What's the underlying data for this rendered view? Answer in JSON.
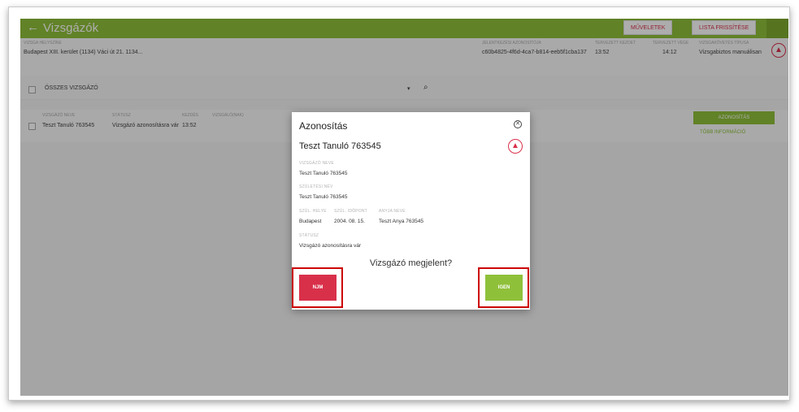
{
  "topbar": {
    "back_icon": "arrow-left-icon",
    "title": "Vizsgázók",
    "actions_label": "MŰVELETEK",
    "refresh_label": "LISTA FRISSÍTÉSE"
  },
  "exam_info": {
    "location_label": "VIZSGA HELYSZÍNE",
    "location_value": "Budapest XIII. kerület (1134) Váci út 21. 1134...",
    "id_label": "JELENTKEZÉSI AZONOSÍTÓJA",
    "id_value": "c60b4825-4f6d-4ca7-b814-eeb5f1cba137",
    "planned_start_label": "TERVEZETT KEZDET",
    "planned_start_value": "13:52",
    "planned_end_label": "TERVEZETT VÉGE",
    "planned_end_value": "14:12",
    "exam_type_label": "VIZSGAKÖVETÉS TÍPUSA",
    "exam_type_value": "Vizsgabiztos manuálisan"
  },
  "filter": {
    "all_label": "ÖSSZES VIZSGÁZÓ"
  },
  "table": {
    "headers": [
      "VIZSGÁZÓ NEVE",
      "STÁTUSZ",
      "KEZDÉS",
      "VIZSGÁLÓ(NAK)"
    ],
    "row": {
      "name": "Teszt Tanuló 763545",
      "status": "Vizsgázó azonosításra vár",
      "start": "13:52"
    },
    "identify_label": "AZONOSÍTÁS",
    "more_info_label": "TÖBB INFORMÁCIÓ"
  },
  "modal": {
    "title": "Azonosítás",
    "name": "Teszt Tanuló 763545",
    "exam_name_label": "VIZSGÁZÓ NEVE",
    "exam_name_value": "Teszt Tanuló 763545",
    "birth_name_label": "SZÜLETÉSI NÉV",
    "birth_name_value": "Teszt Tanuló 763545",
    "birth_place_label": "SZÜL. HELYE",
    "birth_place_value": "Budapest",
    "birth_date_label": "SZÜL. IDŐPONT",
    "birth_date_value": "2004. 08. 15.",
    "mother_label": "ANYJA NEVE",
    "mother_value": "Teszt Anya 763545",
    "status_label": "STÁTUSZ",
    "status_value": "Vizsgázó azonosításra vár",
    "question": "Vizsgázó megjelent?",
    "no_label": "NJM",
    "yes_label": "IGEN"
  },
  "colors": {
    "green": "#8fc03a",
    "red": "#d9304a",
    "highlight": "#cc0000"
  }
}
